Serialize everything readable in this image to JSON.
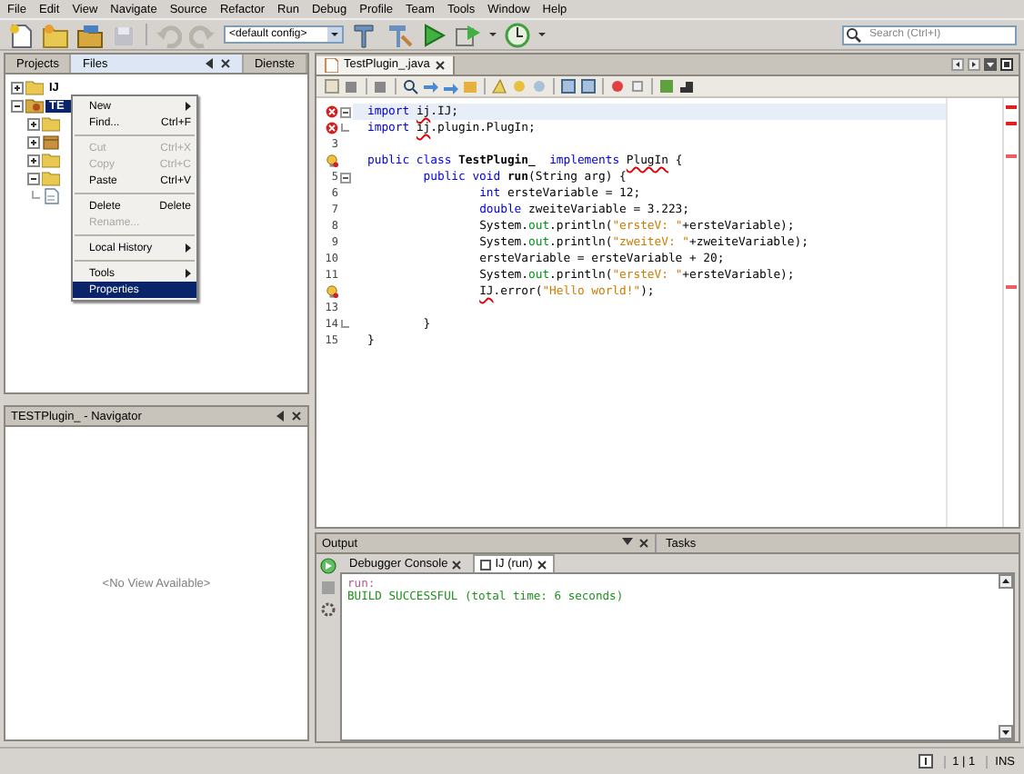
{
  "menu_bar": [
    "File",
    "Edit",
    "View",
    "Navigate",
    "Source",
    "Refactor",
    "Run",
    "Debug",
    "Profile",
    "Team",
    "Tools",
    "Window",
    "Help"
  ],
  "toolbar": {
    "config": "<default config>",
    "search": {
      "placeholder": "Search (Ctrl+I)"
    }
  },
  "projects_panel": {
    "tabs": [
      {
        "label": "Projects",
        "selected": false
      },
      {
        "label": "Files",
        "selected": true
      },
      {
        "label": "Dienste",
        "selected": false
      }
    ],
    "tree": [
      {
        "label": "IJ",
        "kind": "folder",
        "expanded": false,
        "selected": false
      },
      {
        "label": "TE",
        "kind": "project",
        "expanded": true,
        "selected": true,
        "children": [
          {
            "kind": "folder",
            "expanded": false
          },
          {
            "kind": "package",
            "expanded": false
          },
          {
            "kind": "folder",
            "expanded": false
          },
          {
            "kind": "folder",
            "expanded": true
          },
          {
            "kind": "file"
          }
        ]
      }
    ]
  },
  "context_menu": [
    {
      "kind": "item",
      "label": "New",
      "submenu": true,
      "disabled": false,
      "selected": false
    },
    {
      "kind": "item",
      "label": "Find...",
      "shortcut": "Ctrl+F",
      "disabled": false,
      "selected": false
    },
    {
      "kind": "separator"
    },
    {
      "kind": "item",
      "label": "Cut",
      "shortcut": "Ctrl+X",
      "disabled": true,
      "selected": false
    },
    {
      "kind": "item",
      "label": "Copy",
      "shortcut": "Ctrl+C",
      "disabled": true,
      "selected": false
    },
    {
      "kind": "item",
      "label": "Paste",
      "shortcut": "Ctrl+V",
      "disabled": false,
      "selected": false
    },
    {
      "kind": "separator"
    },
    {
      "kind": "item",
      "label": "Delete",
      "shortcut": "Delete",
      "disabled": false,
      "selected": false
    },
    {
      "kind": "item",
      "label": "Rename...",
      "disabled": true,
      "selected": false
    },
    {
      "kind": "separator"
    },
    {
      "kind": "item",
      "label": "Local History",
      "submenu": true,
      "disabled": false,
      "selected": false
    },
    {
      "kind": "separator"
    },
    {
      "kind": "item",
      "label": "Tools",
      "submenu": true,
      "disabled": false,
      "selected": false
    },
    {
      "kind": "item",
      "label": "Properties",
      "disabled": false,
      "selected": true
    }
  ],
  "navigator": {
    "title": "TESTPlugin_ - Navigator",
    "empty_text": "<No View Available>"
  },
  "editor": {
    "tab": "TestPlugin_.java",
    "lines": [
      {
        "kind": "error",
        "foldable": true,
        "current": true,
        "tokens": [
          {
            "text": "import ",
            "kind": "keyword"
          },
          {
            "text": "ij",
            "kind": "error"
          },
          {
            "text": ".IJ;",
            "kind": "plain"
          }
        ]
      },
      {
        "kind": "error",
        "fold_end": true,
        "current": false,
        "tokens": [
          {
            "text": "import ",
            "kind": "keyword"
          },
          {
            "text": "ij",
            "kind": "error"
          },
          {
            "text": ".plugin.PlugIn;",
            "kind": "plain"
          }
        ]
      },
      {
        "kind": "plain",
        "number": "3"
      },
      {
        "kind": "warning",
        "current": false,
        "tokens": [
          {
            "text": "public class ",
            "kind": "keyword"
          },
          {
            "text": "TestPlugin_  ",
            "kind": "bold"
          },
          {
            "text": "implements ",
            "kind": "keyword"
          },
          {
            "text": "PlugIn",
            "kind": "error"
          },
          {
            "text": " {",
            "kind": "plain"
          }
        ]
      },
      {
        "kind": "plain",
        "number": "5",
        "foldable": true,
        "current": false,
        "tokens": [
          {
            "text": "        public void ",
            "kind": "keyword"
          },
          {
            "text": "run",
            "kind": "bold"
          },
          {
            "text": "(String arg) {",
            "kind": "plain"
          }
        ]
      },
      {
        "kind": "plain",
        "number": "6",
        "current": false,
        "tokens": [
          {
            "text": "                int ",
            "kind": "keyword"
          },
          {
            "text": "ersteVariable = 12;",
            "kind": "plain"
          }
        ]
      },
      {
        "kind": "plain",
        "number": "7",
        "current": false,
        "tokens": [
          {
            "text": "                double ",
            "kind": "keyword"
          },
          {
            "text": "zweiteVariable = 3.223;",
            "kind": "plain"
          }
        ]
      },
      {
        "kind": "plain",
        "number": "8",
        "current": false,
        "tokens": [
          {
            "text": "                System.",
            "kind": "plain"
          },
          {
            "text": "out",
            "kind": "field"
          },
          {
            "text": ".println(",
            "kind": "plain"
          },
          {
            "text": "\"ersteV: \"",
            "kind": "string"
          },
          {
            "text": "+ersteVariable);",
            "kind": "plain"
          }
        ]
      },
      {
        "kind": "plain",
        "number": "9",
        "current": false,
        "tokens": [
          {
            "text": "                System.",
            "kind": "plain"
          },
          {
            "text": "out",
            "kind": "field"
          },
          {
            "text": ".println(",
            "kind": "plain"
          },
          {
            "text": "\"zweiteV: \"",
            "kind": "string"
          },
          {
            "text": "+zweiteVariable);",
            "kind": "plain"
          }
        ]
      },
      {
        "kind": "plain",
        "number": "10",
        "current": false,
        "tokens": [
          {
            "text": "                ersteVariable = ersteVariable + 20;",
            "kind": "plain"
          }
        ]
      },
      {
        "kind": "plain",
        "number": "11",
        "current": false,
        "tokens": [
          {
            "text": "                System.",
            "kind": "plain"
          },
          {
            "text": "out",
            "kind": "field"
          },
          {
            "text": ".println(",
            "kind": "plain"
          },
          {
            "text": "\"ersteV: \"",
            "kind": "string"
          },
          {
            "text": "+ersteVariable);",
            "kind": "plain"
          }
        ]
      },
      {
        "kind": "warning",
        "current": false,
        "tokens": [
          {
            "text": "                IJ",
            "kind": "error"
          },
          {
            "text": ".error(",
            "kind": "plain"
          },
          {
            "text": "\"Hello world!\"",
            "kind": "string"
          },
          {
            "text": ");",
            "kind": "plain"
          }
        ]
      },
      {
        "kind": "plain",
        "number": "13"
      },
      {
        "kind": "plain",
        "number": "14",
        "fold_end": true,
        "current": false,
        "tokens": [
          {
            "text": "        }",
            "kind": "plain"
          }
        ]
      },
      {
        "kind": "plain",
        "number": "15",
        "current": false,
        "tokens": [
          {
            "text": "}",
            "kind": "plain"
          }
        ]
      }
    ]
  },
  "output": {
    "title": "Output",
    "side_tab": "Tasks",
    "tabs": [
      {
        "label": "Debugger Console",
        "selected": false
      },
      {
        "label": "IJ (run)",
        "selected": true
      }
    ],
    "lines": [
      {
        "text": "run:",
        "kind": "info"
      },
      {
        "text": "BUILD SUCCESSFUL (total time: 6 seconds)",
        "kind": "success"
      }
    ]
  },
  "status_bar": {
    "position": "1 | 1",
    "mode": "INS"
  }
}
